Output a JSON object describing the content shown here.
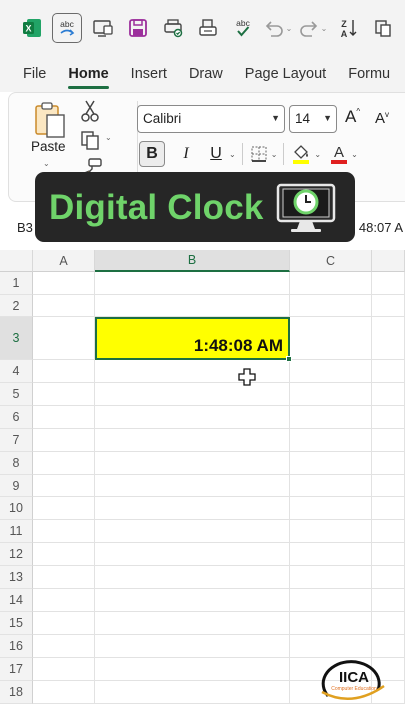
{
  "quick_access": {
    "icons": [
      "excel-logo-icon",
      "spelling-icon",
      "screen-icon",
      "save-icon",
      "print-preview-icon",
      "print-icon",
      "spell-check-icon",
      "undo-icon",
      "redo-icon",
      "sort-az-icon",
      "copy-icon"
    ],
    "spelling_label": "abc",
    "sort_label": "AZ"
  },
  "tabs": [
    "File",
    "Home",
    "Insert",
    "Draw",
    "Page Layout",
    "Formu"
  ],
  "active_tab": "Home",
  "ribbon": {
    "paste_label": "Paste",
    "font_name": "Calibri",
    "font_size": "14",
    "grow_label": "A",
    "shrink_label": "A",
    "bold_label": "B",
    "italic_label": "I",
    "underline_label": "U",
    "fill_color": "#ffff00",
    "font_color": "#e02020",
    "font_color_letter": "A"
  },
  "formula_bar": {
    "name_box": "B3",
    "formula_fragment": "48:07 A"
  },
  "banner": {
    "title": "Digital Clock",
    "icon": "computer-clock-icon"
  },
  "sheet": {
    "columns": [
      "A",
      "B",
      "C"
    ],
    "rows": [
      "1",
      "2",
      "3",
      "4",
      "5",
      "6",
      "7",
      "8",
      "9",
      "10",
      "11",
      "12",
      "13",
      "14",
      "15",
      "16",
      "17",
      "18"
    ],
    "active_cell": "B3",
    "active_value": "1:48:08 AM",
    "active_fill": "#ffff00"
  },
  "logo": {
    "name": "IICA",
    "tagline": "Computer Education"
  }
}
